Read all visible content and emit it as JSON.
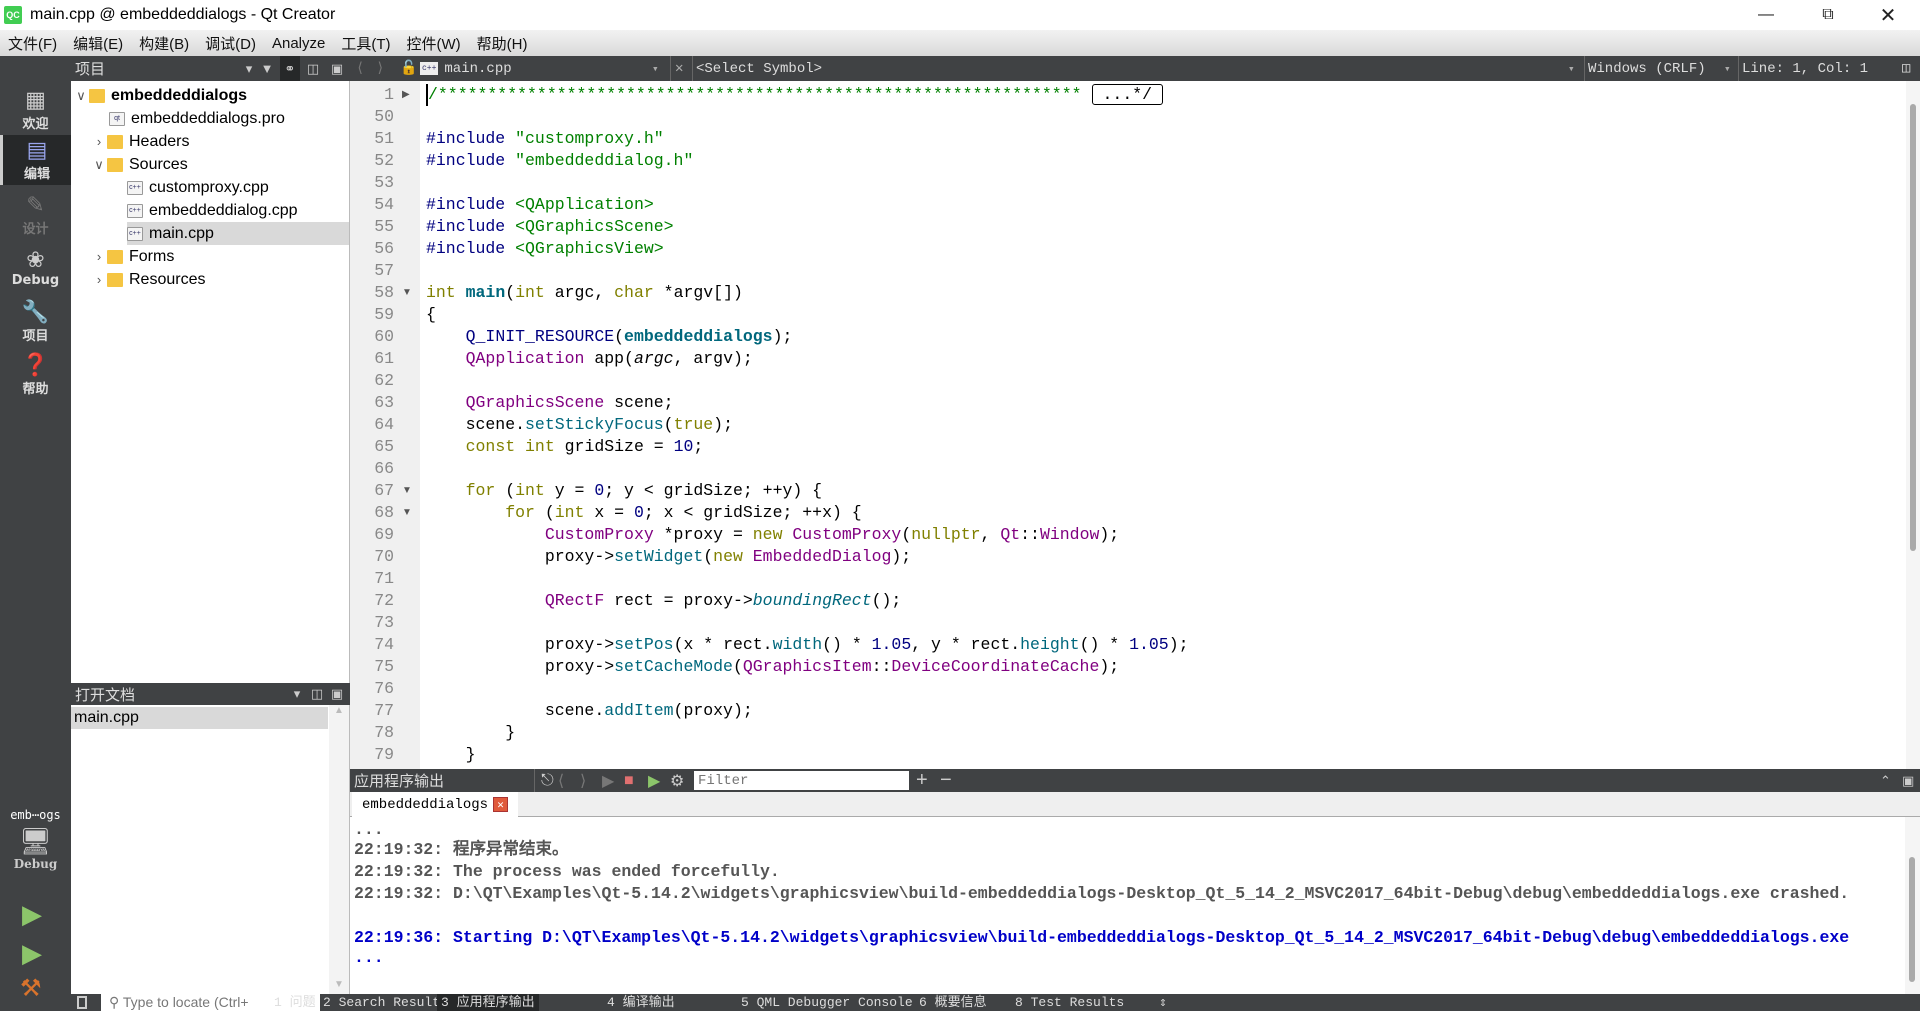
{
  "window": {
    "title": "main.cpp @ embeddeddialogs - Qt Creator",
    "logo": "QC",
    "minimize_icon": "minimize",
    "restore_icon": "restore",
    "close_icon": "close"
  },
  "menu": [
    "文件(F)",
    "编辑(E)",
    "构建(B)",
    "调试(D)",
    "Analyze",
    "工具(T)",
    "控件(W)",
    "帮助(H)"
  ],
  "modes": [
    {
      "label": "欢迎",
      "icon": "grid-icon"
    },
    {
      "label": "编辑",
      "icon": "edit-icon",
      "selected": true
    },
    {
      "label": "设计",
      "icon": "pencil-icon",
      "disabled": true
    },
    {
      "label": "Debug",
      "icon": "bug-icon"
    },
    {
      "label": "项目",
      "icon": "wrench-icon"
    },
    {
      "label": "帮助",
      "icon": "help-icon"
    }
  ],
  "kit": {
    "project": "emb⋯ogs",
    "config": "Debug"
  },
  "project_panel": {
    "title": "项目",
    "tree": [
      {
        "label": "embeddeddialogs",
        "bold": true,
        "expanded": true
      },
      {
        "label": "embeddeddialogs.pro"
      },
      {
        "label": "Headers",
        "expanded": false
      },
      {
        "label": "Sources",
        "expanded": true
      },
      {
        "label": "customproxy.cpp"
      },
      {
        "label": "embeddeddialog.cpp"
      },
      {
        "label": "main.cpp",
        "selected": true
      },
      {
        "label": "Forms",
        "expanded": false
      },
      {
        "label": "Resources",
        "expanded": false
      }
    ]
  },
  "open_docs": {
    "title": "打开文档",
    "items": [
      "main.cpp"
    ]
  },
  "editor": {
    "file": "main.cpp",
    "symbol": "<Select Symbol>",
    "line_ending": "Windows (CRLF)",
    "position": "Line: 1, Col: 1",
    "fold_placeholder": "...*/",
    "lines": [
      {
        "n": "1",
        "fold": "right",
        "tokens": [
          {
            "t": "/*****************************************************************",
            "c": "cm"
          }
        ]
      },
      {
        "n": "50",
        "tokens": []
      },
      {
        "n": "51",
        "tokens": [
          {
            "t": "#include ",
            "c": "pp"
          },
          {
            "t": "\"customproxy.h\"",
            "c": "st"
          }
        ]
      },
      {
        "n": "52",
        "tokens": [
          {
            "t": "#include ",
            "c": "pp"
          },
          {
            "t": "\"embeddeddialog.h\"",
            "c": "st"
          }
        ]
      },
      {
        "n": "53",
        "tokens": []
      },
      {
        "n": "54",
        "tokens": [
          {
            "t": "#include ",
            "c": "pp"
          },
          {
            "t": "<QApplication>",
            "c": "st"
          }
        ]
      },
      {
        "n": "55",
        "tokens": [
          {
            "t": "#include ",
            "c": "pp"
          },
          {
            "t": "<QGraphicsScene>",
            "c": "st"
          }
        ]
      },
      {
        "n": "56",
        "tokens": [
          {
            "t": "#include ",
            "c": "pp"
          },
          {
            "t": "<QGraphicsView>",
            "c": "st"
          }
        ]
      },
      {
        "n": "57",
        "tokens": []
      },
      {
        "n": "58",
        "fold": "down",
        "tokens": [
          {
            "t": "int ",
            "c": "kw"
          },
          {
            "t": "main",
            "c": "fb"
          },
          {
            "t": "("
          },
          {
            "t": "int ",
            "c": "kw"
          },
          {
            "t": "argc, "
          },
          {
            "t": "char ",
            "c": "kw"
          },
          {
            "t": "*argv[])"
          }
        ]
      },
      {
        "n": "59",
        "tokens": [
          {
            "t": "{"
          }
        ]
      },
      {
        "n": "60",
        "tokens": [
          {
            "t": "    "
          },
          {
            "t": "Q_INIT_RESOURCE",
            "c": "pp"
          },
          {
            "t": "("
          },
          {
            "t": "embeddeddialogs",
            "c": "fb"
          },
          {
            "t": ");"
          }
        ]
      },
      {
        "n": "61",
        "tokens": [
          {
            "t": "    "
          },
          {
            "t": "QApplication",
            "c": "ty"
          },
          {
            "t": " app("
          },
          {
            "t": "argc",
            "c": "it2"
          },
          {
            "t": ", argv);"
          }
        ]
      },
      {
        "n": "62",
        "tokens": []
      },
      {
        "n": "63",
        "tokens": [
          {
            "t": "    "
          },
          {
            "t": "QGraphicsScene",
            "c": "ty"
          },
          {
            "t": " scene;"
          }
        ]
      },
      {
        "n": "64",
        "tokens": [
          {
            "t": "    scene."
          },
          {
            "t": "setStickyFocus",
            "c": "fn"
          },
          {
            "t": "("
          },
          {
            "t": "true",
            "c": "kw"
          },
          {
            "t": ");"
          }
        ]
      },
      {
        "n": "65",
        "tokens": [
          {
            "t": "    "
          },
          {
            "t": "const int ",
            "c": "kw"
          },
          {
            "t": "gridSize = "
          },
          {
            "t": "10",
            "c": "nu"
          },
          {
            "t": ";"
          }
        ]
      },
      {
        "n": "66",
        "tokens": []
      },
      {
        "n": "67",
        "fold": "down",
        "tokens": [
          {
            "t": "    "
          },
          {
            "t": "for ",
            "c": "kw"
          },
          {
            "t": "("
          },
          {
            "t": "int ",
            "c": "kw"
          },
          {
            "t": "y = "
          },
          {
            "t": "0",
            "c": "nu"
          },
          {
            "t": "; y < gridSize; ++y) {"
          }
        ]
      },
      {
        "n": "68",
        "fold": "down",
        "tokens": [
          {
            "t": "        "
          },
          {
            "t": "for ",
            "c": "kw"
          },
          {
            "t": "("
          },
          {
            "t": "int ",
            "c": "kw"
          },
          {
            "t": "x = "
          },
          {
            "t": "0",
            "c": "nu"
          },
          {
            "t": "; x < gridSize; ++x) {"
          }
        ]
      },
      {
        "n": "69",
        "tokens": [
          {
            "t": "            "
          },
          {
            "t": "CustomProxy",
            "c": "ty"
          },
          {
            "t": " *proxy = "
          },
          {
            "t": "new ",
            "c": "kw"
          },
          {
            "t": "CustomProxy",
            "c": "ty"
          },
          {
            "t": "("
          },
          {
            "t": "nullptr",
            "c": "kw"
          },
          {
            "t": ", "
          },
          {
            "t": "Qt",
            "c": "ty"
          },
          {
            "t": "::"
          },
          {
            "t": "Window",
            "c": "ty"
          },
          {
            "t": ");"
          }
        ]
      },
      {
        "n": "70",
        "tokens": [
          {
            "t": "            proxy->"
          },
          {
            "t": "setWidget",
            "c": "fn"
          },
          {
            "t": "("
          },
          {
            "t": "new ",
            "c": "kw"
          },
          {
            "t": "EmbeddedDialog",
            "c": "ty"
          },
          {
            "t": ");"
          }
        ]
      },
      {
        "n": "71",
        "tokens": []
      },
      {
        "n": "72",
        "tokens": [
          {
            "t": "            "
          },
          {
            "t": "QRectF",
            "c": "ty"
          },
          {
            "t": " rect = proxy->"
          },
          {
            "t": "boundingRect",
            "c": "fi"
          },
          {
            "t": "();"
          }
        ]
      },
      {
        "n": "73",
        "tokens": []
      },
      {
        "n": "74",
        "tokens": [
          {
            "t": "            proxy->"
          },
          {
            "t": "setPos",
            "c": "fn"
          },
          {
            "t": "(x * rect."
          },
          {
            "t": "width",
            "c": "fn"
          },
          {
            "t": "() * "
          },
          {
            "t": "1.05",
            "c": "nu"
          },
          {
            "t": ", y * rect."
          },
          {
            "t": "height",
            "c": "fn"
          },
          {
            "t": "() * "
          },
          {
            "t": "1.05",
            "c": "nu"
          },
          {
            "t": ");"
          }
        ]
      },
      {
        "n": "75",
        "tokens": [
          {
            "t": "            proxy->"
          },
          {
            "t": "setCacheMode",
            "c": "fn"
          },
          {
            "t": "("
          },
          {
            "t": "QGraphicsItem",
            "c": "ty"
          },
          {
            "t": "::"
          },
          {
            "t": "DeviceCoordinateCache",
            "c": "ty"
          },
          {
            "t": ");"
          }
        ]
      },
      {
        "n": "76",
        "tokens": []
      },
      {
        "n": "77",
        "tokens": [
          {
            "t": "            scene."
          },
          {
            "t": "addItem",
            "c": "fn"
          },
          {
            "t": "(proxy);"
          }
        ]
      },
      {
        "n": "78",
        "tokens": [
          {
            "t": "        }"
          }
        ]
      },
      {
        "n": "79",
        "tokens": [
          {
            "t": "    }"
          }
        ]
      }
    ]
  },
  "output_pane": {
    "title": "应用程序输出",
    "filter_placeholder": "Filter",
    "tab": "embeddeddialogs",
    "lines": [
      {
        "text": "...",
        "color": "gray"
      },
      {
        "text": "22:19:32: 程序异常结束。",
        "color": "gray"
      },
      {
        "text": "22:19:32: The process was ended forcefully.",
        "color": "gray"
      },
      {
        "text": "22:19:32: D:\\QT\\Examples\\Qt-5.14.2\\widgets\\graphicsview\\build-embeddeddialogs-Desktop_Qt_5_14_2_MSVC2017_64bit-Debug\\debug\\embeddeddialogs.exe crashed.",
        "color": "gray"
      },
      {
        "text": "",
        "color": "gray"
      },
      {
        "text": "22:19:36: Starting D:\\QT\\Examples\\Qt-5.14.2\\widgets\\graphicsview\\build-embeddeddialogs-Desktop_Qt_5_14_2_MSVC2017_64bit-Debug\\debug\\embeddeddialogs.exe",
        "color": "blue"
      },
      {
        "text": "...",
        "color": "blue"
      }
    ]
  },
  "statusbar": {
    "locate_placeholder": "Type to locate (Ctrl+",
    "tabs": [
      "1 问题",
      "2 Search Results",
      "3 应用程序输出",
      "4 编译输出",
      "5 QML Debugger Console",
      "6 概要信息",
      "8 Test Results"
    ],
    "active_tab": 2
  },
  "colors": {
    "dark_panel": "#404244",
    "keyword": "#808000",
    "type": "#800080",
    "function": "#00677c",
    "string": "#008000",
    "number": "#000080",
    "output_blue": "#0000c8",
    "run_green": "#8cc56a",
    "stop_red": "#e07070"
  }
}
